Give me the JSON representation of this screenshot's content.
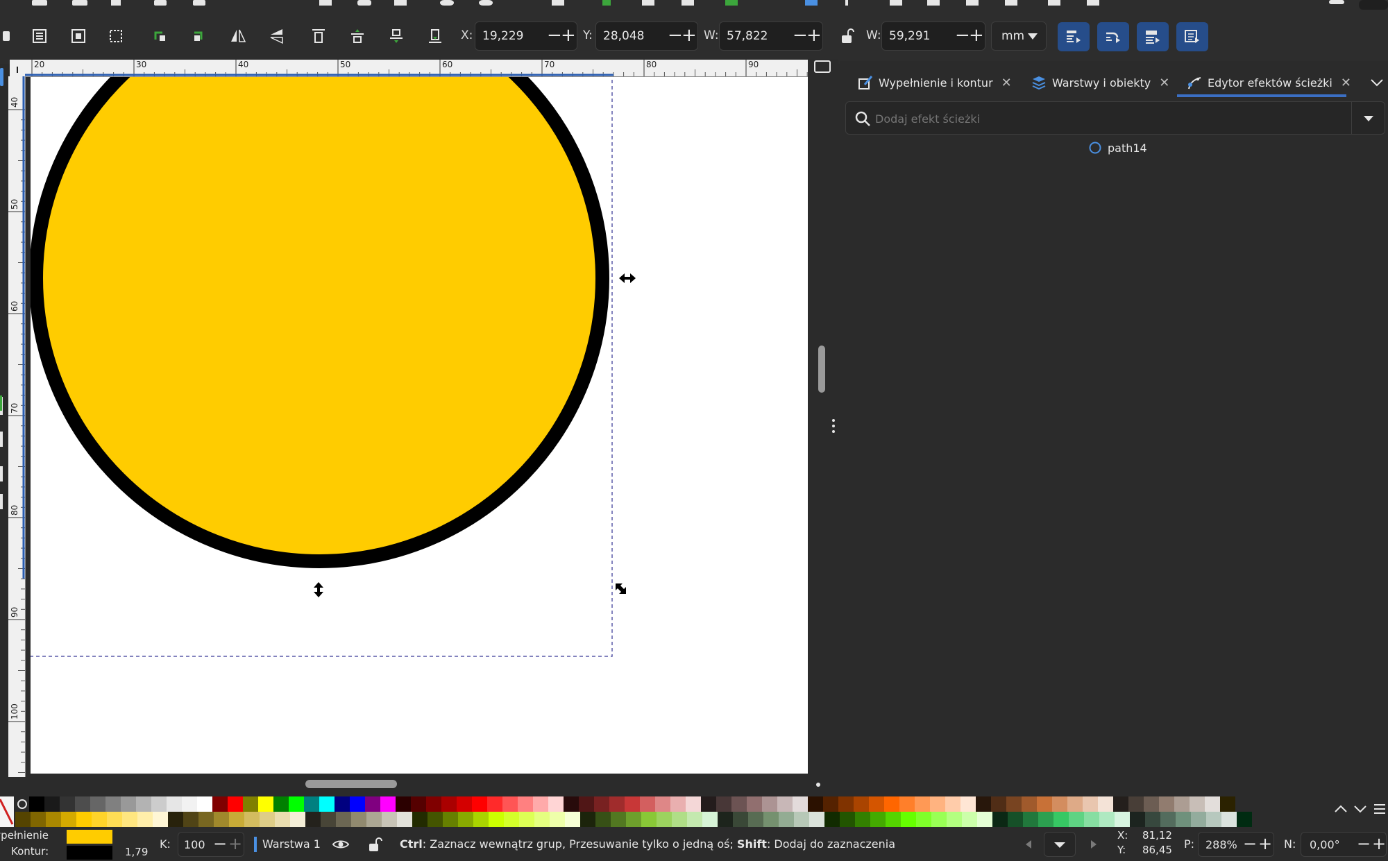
{
  "toolbar": {
    "x_label": "X:",
    "x_value": "19,229",
    "y_label": "Y:",
    "y_value": "28,048",
    "w_label": "W:",
    "w_value": "57,822",
    "h_label": "W:",
    "h_value": "59,291",
    "unit": "mm"
  },
  "ruler": {
    "h_ticks": [
      "20",
      "30",
      "40",
      "50",
      "60",
      "70",
      "80",
      "90"
    ],
    "v_ticks": [
      "40",
      "50",
      "60",
      "70",
      "80",
      "90",
      "100"
    ]
  },
  "canvas": {
    "fill_color": "#ffcc00",
    "stroke_color": "#000000",
    "page_color": "#ffffff"
  },
  "panel": {
    "tabs": [
      {
        "label": "Wypełnienie i kontur"
      },
      {
        "label": "Warstwy i obiekty"
      },
      {
        "label": "Edytor efektów ścieżki"
      }
    ],
    "search_placeholder": "Dodaj efekt ścieżki",
    "object_name": "path14"
  },
  "palette_colors_top": [
    "#000000",
    "#1a1a1a",
    "#333333",
    "#4d4d4d",
    "#666666",
    "#808080",
    "#999999",
    "#b3b3b3",
    "#cccccc",
    "#e6e6e6",
    "#f2f2f2",
    "#ffffff",
    "#800000",
    "#ff0000",
    "#808000",
    "#ffff00",
    "#008000",
    "#00ff00",
    "#008080",
    "#00ffff",
    "#000080",
    "#0000ff",
    "#800080",
    "#ff00ff",
    "#2b0000",
    "#550000",
    "#800000",
    "#aa0000",
    "#d40000",
    "#ff0000",
    "#ff2a2a",
    "#ff5555",
    "#ff8080",
    "#ffaaaa",
    "#ffd5d5",
    "#280b0b",
    "#501616",
    "#782121",
    "#a02c2c",
    "#c83737",
    "#d35f5f",
    "#de8787",
    "#e9afaf",
    "#f4d7d7",
    "#241c1c",
    "#483737",
    "#6c5353",
    "#916f6f",
    "#ac9393",
    "#c8b7b7",
    "#e3dbdb",
    "#2b1100",
    "#552200",
    "#803300",
    "#aa4400",
    "#d45500",
    "#ff6600",
    "#ff7f2a",
    "#ff9955",
    "#ffb380",
    "#ffccaa",
    "#ffe6d5",
    "#28170b",
    "#502d16",
    "#784421",
    "#a05a2c",
    "#c87137",
    "#d38d5f",
    "#deaa87",
    "#e9c6af",
    "#f4e3d7",
    "#241f1c",
    "#483e37",
    "#6c5d53",
    "#917c6f",
    "#ac9d93",
    "#c8beb7",
    "#e3dedb",
    "#2b2200"
  ],
  "palette_colors_bottom": [
    "#554400",
    "#806600",
    "#aa8800",
    "#d4aa00",
    "#ffcc00",
    "#ffd42a",
    "#ffdd55",
    "#ffe680",
    "#ffeeaa",
    "#fff6d5",
    "#28220b",
    "#504416",
    "#786721",
    "#a0892c",
    "#c8ab37",
    "#d3bc5f",
    "#decd87",
    "#e9ddaf",
    "#f4eed7",
    "#24221c",
    "#484537",
    "#6c6753",
    "#918a6f",
    "#aca793",
    "#c8c4b7",
    "#e3e2db",
    "#222b00",
    "#445500",
    "#668000",
    "#88aa00",
    "#aad400",
    "#ccff00",
    "#d4ff2a",
    "#ddff55",
    "#e5ff80",
    "#eeffaa",
    "#f6ffd5",
    "#1c240b",
    "#375016",
    "#527821",
    "#6ea02c",
    "#89c837",
    "#9cd35f",
    "#b0de87",
    "#c4e9af",
    "#d7f4d7",
    "#1d241c",
    "#3a4837",
    "#586c53",
    "#75916f",
    "#93ac93",
    "#b7c8b7",
    "#dbe3db",
    "#112b00",
    "#225500",
    "#338000",
    "#44aa00",
    "#55d400",
    "#66ff00",
    "#7fff2a",
    "#99ff55",
    "#b3ff80",
    "#ccffaa",
    "#e5ffd5",
    "#0b2814",
    "#165028",
    "#21783c",
    "#2ca050",
    "#37c864",
    "#5fd383",
    "#87dea2",
    "#afe9c1",
    "#d7f4e0",
    "#1c241f",
    "#37483e",
    "#536c5d",
    "#6f917c",
    "#93ac9d",
    "#b7c8be",
    "#dbe3de",
    "#002b11"
  ],
  "status": {
    "fill_label": "Wypełnienie:",
    "stroke_label": "Kontur:",
    "fill_color": "#ffcc00",
    "stroke_color": "#000000",
    "stroke_width": "1,79",
    "opacity_label": "K:",
    "opacity_value": "100",
    "layer_name": "Warstwa 1",
    "hint_key1": "Ctrl",
    "hint_text1": ": Zaznacz wewnątrz grup, Przesuwanie tylko o jedną oś; ",
    "hint_key2": "Shift",
    "hint_text2": ": Dodaj do zaznaczenia",
    "cursor_x_label": "X:",
    "cursor_x": "81,12",
    "cursor_y_label": "Y:",
    "cursor_y": "86,45",
    "zoom_label": "P:",
    "zoom_value": "288%",
    "rotate_label": "N:",
    "rotate_value": "0,00°"
  }
}
